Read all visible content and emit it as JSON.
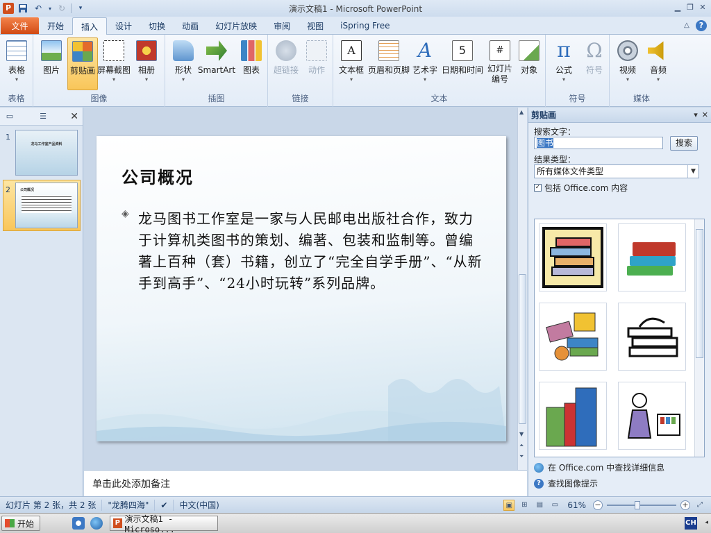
{
  "window": {
    "title": "演示文稿1 - Microsoft PowerPoint",
    "app_icon": "P"
  },
  "tabs": {
    "file": "文件",
    "items": [
      "开始",
      "插入",
      "设计",
      "切换",
      "动画",
      "幻灯片放映",
      "审阅",
      "视图",
      "iSpring Free"
    ],
    "active": "插入"
  },
  "ribbon": {
    "groups": [
      {
        "label": "表格",
        "buttons": [
          "表格"
        ]
      },
      {
        "label": "图像",
        "buttons": [
          "图片",
          "剪贴画",
          "屏幕截图",
          "相册"
        ]
      },
      {
        "label": "插图",
        "buttons": [
          "形状",
          "SmartArt",
          "图表"
        ]
      },
      {
        "label": "链接",
        "buttons": [
          "超链接",
          "动作"
        ]
      },
      {
        "label": "文本",
        "buttons": [
          "文本框",
          "页眉和页脚",
          "艺术字",
          "日期和时间",
          "幻灯片编号",
          "对象"
        ]
      },
      {
        "label": "符号",
        "buttons": [
          "公式",
          "符号"
        ]
      },
      {
        "label": "媒体",
        "buttons": [
          "视频",
          "音频"
        ]
      }
    ],
    "slide_number_line1": "幻灯片",
    "slide_number_line2": "编号"
  },
  "slides_pane": {
    "slides": [
      {
        "number": "1",
        "thumb_title": "龙马工作室产品资料"
      },
      {
        "number": "2",
        "thumb_title": "公司概况"
      }
    ]
  },
  "slide": {
    "title": "公司概况",
    "bullet": "◈",
    "body": "龙马图书工作室是一家与人民邮电出版社合作，致力于计算机类图书的策划、编著、包装和监制等。曾编著上百种（套）书籍，创立了“完全自学手册”、“从新手到高手”、“24小时玩转”系列品牌。"
  },
  "notes": {
    "placeholder": "单击此处添加备注"
  },
  "clip_pane": {
    "title": "剪贴画",
    "search_label": "搜索文字：",
    "search_value": "图书",
    "search_button": "搜索",
    "result_type_label": "结果类型：",
    "result_type_value": "所有媒体文件类型",
    "include_office": "包括 Office.com 内容",
    "link_more": "在 Office.com 中查找详细信息",
    "link_tips": "查找图像提示"
  },
  "statusbar": {
    "slide_info": "幻灯片 第 2 张，共 2 张",
    "theme": "\"龙腾四海\"",
    "language": "中文(中国)",
    "zoom": "61%"
  },
  "taskbar": {
    "start": "开始",
    "task": "演示文稿1 - Microso...",
    "ime": "CH"
  }
}
